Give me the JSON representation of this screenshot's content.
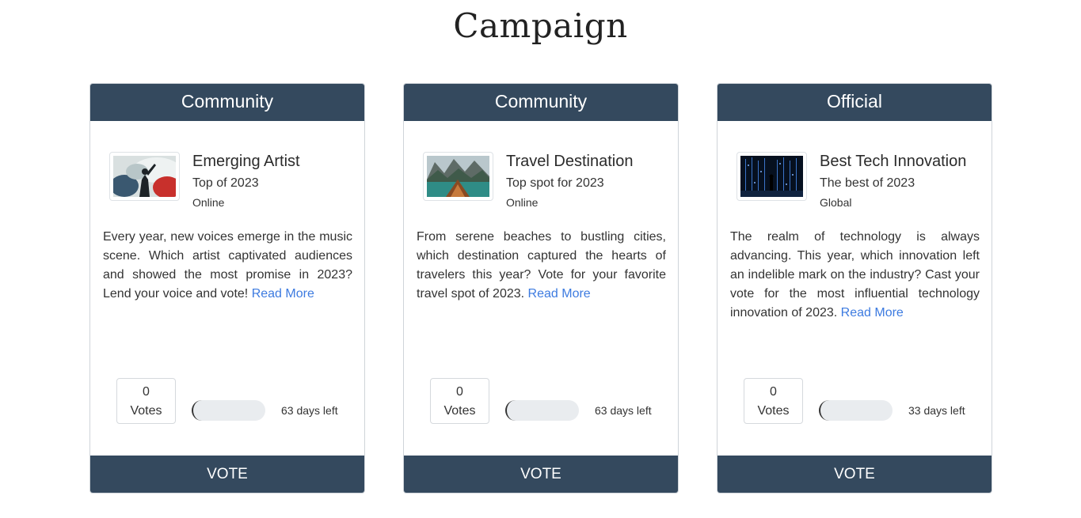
{
  "page": {
    "title": "Campaign"
  },
  "campaigns": [
    {
      "category": "Community",
      "title": "Emerging Artist",
      "subtitle": "Top of 2023",
      "location": "Online",
      "image_icon": "concert-singer-image",
      "description": "Every year, new voices emerge in the music scene. Which artist captivated audiences and showed the most promise in 2023? Lend your voice and vote!",
      "read_more": "Read More",
      "votes_count": "0",
      "votes_label": "Votes",
      "progress": 0,
      "days_left": "63 days left",
      "vote_label": "VOTE"
    },
    {
      "category": "Community",
      "title": "Travel Destination",
      "subtitle": "Top spot for 2023",
      "location": "Online",
      "image_icon": "lake-boat-image",
      "description": "From serene beaches to bustling cities, which destination captured the hearts of travelers this year? Vote for your favorite travel spot of 2023.",
      "read_more": "Read More",
      "votes_count": "0",
      "votes_label": "Votes",
      "progress": 0,
      "days_left": "63 days left",
      "vote_label": "VOTE"
    },
    {
      "category": "Official",
      "title": "Best Tech Innovation",
      "subtitle": "The best of 2023",
      "location": "Global",
      "image_icon": "digital-lights-image",
      "description": "The realm of technology is always advancing. This year, which innovation left an indelible mark on the industry? Cast your vote for the most influential technology innovation of 2023.",
      "read_more": "Read More",
      "votes_count": "0",
      "votes_label": "Votes",
      "progress": 0,
      "days_left": "33 days left",
      "vote_label": "VOTE"
    }
  ],
  "colors": {
    "header_bg": "#34495e",
    "link": "#3d7be0",
    "progress_track": "#e9ecef"
  }
}
